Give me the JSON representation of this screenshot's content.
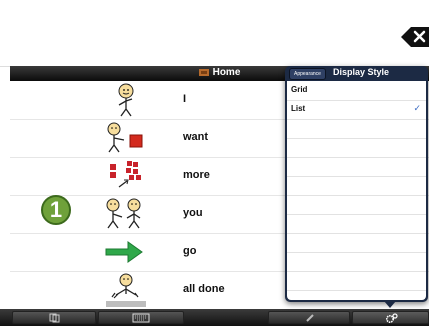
{
  "nav": {
    "title": "Home"
  },
  "board": {
    "rows": [
      {
        "word": "I"
      },
      {
        "word": "want"
      },
      {
        "word": "more"
      },
      {
        "word": "you"
      },
      {
        "word": "go"
      },
      {
        "word": "all done"
      }
    ],
    "selected_badge": "1"
  },
  "popover": {
    "back_label": "Appearance",
    "title": "Display Style",
    "options": [
      {
        "label": "Grid",
        "checked": false
      },
      {
        "label": "List",
        "checked": true
      }
    ],
    "check_glyph": "✓"
  },
  "colors": {
    "popover_bg": "#1c2a44",
    "badge": "#6fa13a",
    "go_arrow": "#2fa84a",
    "want_block": "#d32a1e"
  }
}
